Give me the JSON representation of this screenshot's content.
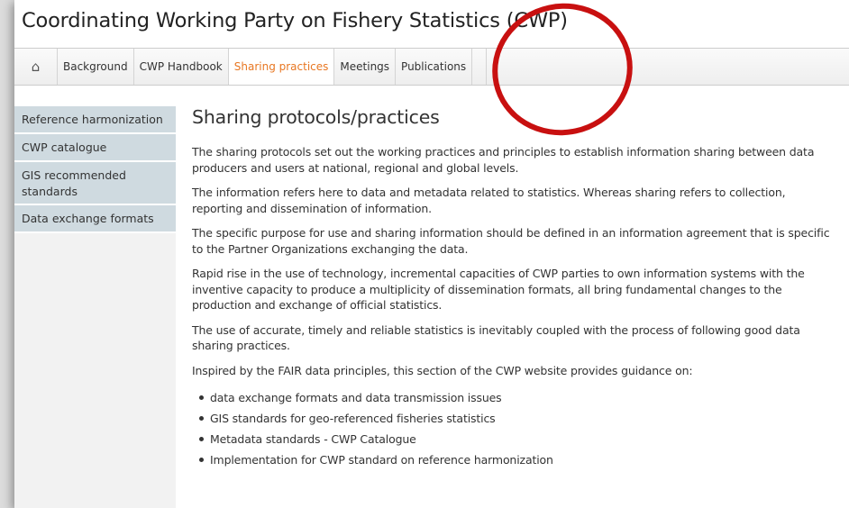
{
  "site": {
    "title": "Coordinating Working Party on Fishery Statistics (CWP)"
  },
  "nav": {
    "home_icon": "home-icon",
    "home_glyph": "⌂",
    "items": [
      {
        "label": "Background"
      },
      {
        "label": "CWP Handbook"
      },
      {
        "label": "Sharing practices",
        "active": true
      },
      {
        "label": "Meetings"
      },
      {
        "label": "Publications"
      }
    ],
    "active_color": "#e87722"
  },
  "sidebar": {
    "items": [
      {
        "label": "Reference harmonization"
      },
      {
        "label": "CWP catalogue"
      },
      {
        "label": "GIS recommended standards"
      },
      {
        "label": "Data exchange formats"
      }
    ],
    "item_background": "#cfdae0"
  },
  "main": {
    "heading": "Sharing protocols/practices",
    "paragraphs": [
      "The sharing protocols set out the working practices and principles to establish information sharing between data producers and users at national, regional and global levels.",
      "The information refers here to data and metadata related to statistics. Whereas sharing refers to collection, reporting and dissemination of information.",
      "The specific purpose for use and sharing information should be defined in an information agreement that is specific to the Partner Organizations exchanging the data.",
      "Rapid rise in the use of technology, incremental capacities of CWP parties to own information systems with the inventive capacity to produce a multiplicity of dissemination formats, all bring fundamental changes to the production and exchange of official statistics.",
      "The use of accurate, timely and reliable statistics is inevitably coupled with the process of following good data sharing practices.",
      "Inspired by the FAIR data principles, this section of the CWP website provides guidance on:"
    ],
    "bullets": [
      "data exchange formats and data transmission issues",
      "GIS standards for geo-referenced fisheries statistics",
      "Metadata standards - CWP Catalogue",
      "Implementation for CWP standard on reference harmonization"
    ]
  },
  "annotation": {
    "shape": "circle",
    "color": "#c81010"
  }
}
